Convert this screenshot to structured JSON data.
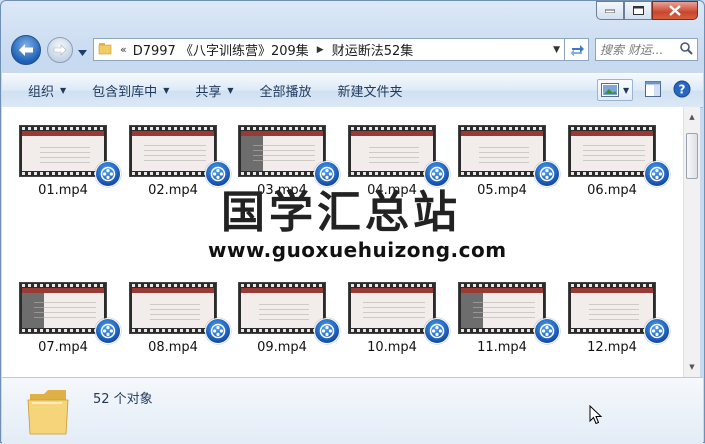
{
  "address": {
    "overflow": "«",
    "segments": [
      "D7997 《八字训练营》209集",
      "财运断法52集"
    ]
  },
  "search": {
    "placeholder": "搜索 财运..."
  },
  "toolbar": {
    "items": [
      {
        "label": "组织",
        "dropdown": true
      },
      {
        "label": "包含到库中",
        "dropdown": true
      },
      {
        "label": "共享",
        "dropdown": true
      },
      {
        "label": "全部播放",
        "dropdown": false
      },
      {
        "label": "新建文件夹",
        "dropdown": false
      }
    ]
  },
  "files": [
    {
      "name": "01.mp4"
    },
    {
      "name": "02.mp4"
    },
    {
      "name": "03.mp4"
    },
    {
      "name": "04.mp4"
    },
    {
      "name": "05.mp4"
    },
    {
      "name": "06.mp4"
    },
    {
      "name": "07.mp4"
    },
    {
      "name": "08.mp4"
    },
    {
      "name": "09.mp4"
    },
    {
      "name": "10.mp4"
    },
    {
      "name": "11.mp4"
    },
    {
      "name": "12.mp4"
    }
  ],
  "watermark": {
    "title": "国学汇总站",
    "url": "www.guoxuehuizong.com"
  },
  "status": {
    "count_text": "52 个对象"
  },
  "colors": {
    "accent": "#1d5fb5",
    "badge": "#1249a6",
    "slide_bar": "#9a3a34"
  }
}
